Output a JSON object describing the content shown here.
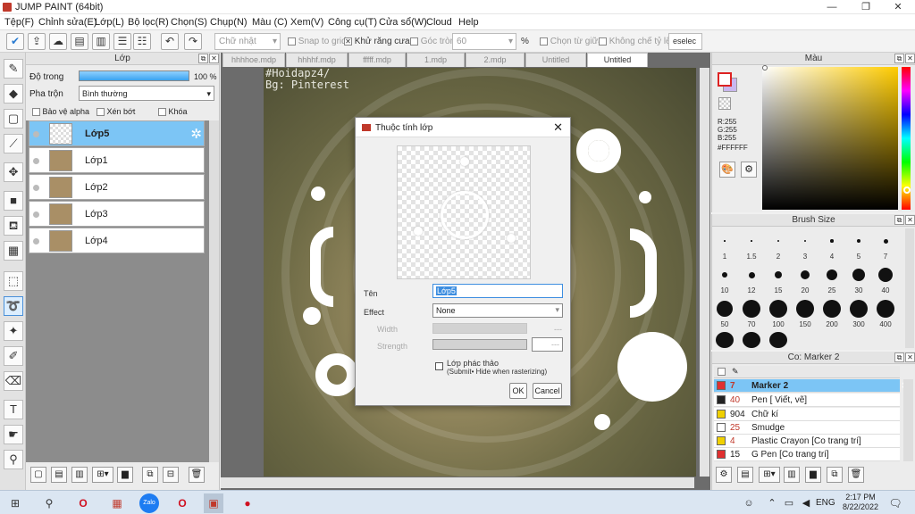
{
  "window": {
    "title": "JUMP PAINT (64bit)",
    "min": "—",
    "max": "❐",
    "close": "✕"
  },
  "menu": [
    "Tệp(F)",
    "Chỉnh sửa(E)",
    "Lớp(L)",
    "Bộ lọc(R)",
    "Chọn(S)",
    "Chụp(N)",
    "Màu (C)",
    "Xem(V)",
    "Công cụ(T)",
    "Cửa sổ(W)",
    "Cloud",
    "Help"
  ],
  "toolbar": {
    "shape_combo": "Chữ nhật",
    "snap": "Snap to grid",
    "antialias": "Khử răng cưa",
    "round_corner": "Góc tròn",
    "round_value": "60",
    "percent": "%",
    "select_center": "Chọn từ giữa",
    "fixed_ratio": "Không chế tỷ lệ",
    "deselect": "eselec"
  },
  "layer_panel": {
    "title": "Lớp",
    "opacity_label": "Độ trong",
    "opacity_value": "100 %",
    "opacity_fraction": 1.0,
    "blend_label": "Pha trộn",
    "blend_value": "Bình thường",
    "protect_alpha": "Bảo vệ alpha",
    "clip": "Xén bớt",
    "lock": "Khóa",
    "layers": [
      "Lớp5",
      "Lớp1",
      "Lớp2",
      "Lớp3",
      "Lớp4"
    ],
    "active_layer": "Lớp5"
  },
  "tabs": [
    "hhhhoe.mdp",
    "hhhhf.mdp",
    "fffff.mdp",
    "1.mdp",
    "2.mdp",
    "Untitled",
    "Untitled"
  ],
  "active_tab": 6,
  "watermark": {
    "line1": "#Hoidapz4/",
    "line2": "Bg: Pinterest"
  },
  "dialog": {
    "title": "Thuộc tính lớp",
    "close": "✕",
    "name_label": "Tên",
    "name_value": "Lớp5",
    "effect_label": "Effect",
    "effect_value": "None",
    "width_label": "Width",
    "width_value": "---",
    "strength_label": "Strength",
    "strength_value": "---",
    "draft_label": "Lớp phác thảo",
    "draft_sub": "(Submit• Hide when rasterizing)",
    "ok": "OK",
    "cancel": "Cancel"
  },
  "color_panel": {
    "title": "Màu",
    "r": "R:255",
    "g": "G:255",
    "b": "B:255",
    "hex": "#FFFFFF",
    "base_color": "#ffcc00"
  },
  "brush_panel": {
    "title": "Brush Size",
    "sizes": [
      "1",
      "1.5",
      "2",
      "3",
      "4",
      "5",
      "7",
      "10",
      "12",
      "15",
      "20",
      "25",
      "30",
      "40",
      "50",
      "70",
      "100",
      "150",
      "200",
      "300",
      "400"
    ]
  },
  "pen_panel": {
    "title": "Co: Marker 2",
    "brushes": [
      {
        "num": "7",
        "name": "Marker 2",
        "color": "#e03030"
      },
      {
        "num": "40",
        "name": "Pen [ Viết, vẽ]",
        "color": "#222222"
      },
      {
        "num": "904",
        "name": "Chữ kí",
        "color": "#f0d000"
      },
      {
        "num": "25",
        "name": "Smudge",
        "color": "#ffffff"
      },
      {
        "num": "4",
        "name": "Plastic Crayon [Co trang trí]",
        "color": "#f0d000"
      },
      {
        "num": "15",
        "name": "G Pen [Co trang trí]",
        "color": "#e03030"
      }
    ]
  },
  "taskbar": {
    "lang": "ENG",
    "time": "2:17 PM",
    "date": "8/22/2022",
    "zalo": "Zalo"
  }
}
